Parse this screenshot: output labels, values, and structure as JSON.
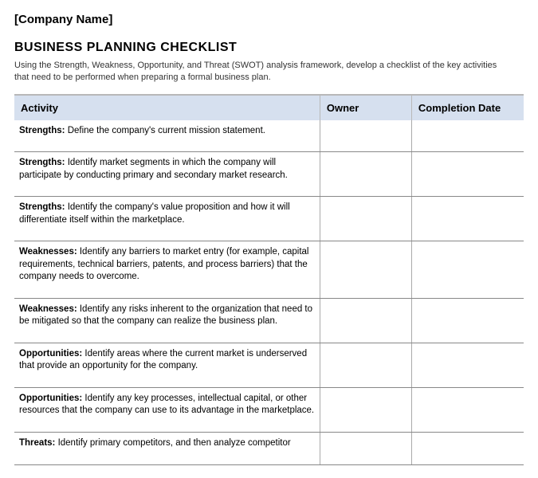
{
  "company_name": "[Company Name]",
  "title": "BUSINESS PLANNING CHECKLIST",
  "description": "Using the Strength, Weakness, Opportunity, and Threat (SWOT) analysis framework, develop a checklist of the key activities that need to be performed when preparing a formal business plan.",
  "headers": {
    "activity": "Activity",
    "owner": "Owner",
    "completion_date": "Completion Date"
  },
  "rows": [
    {
      "category": "Strengths:",
      "text": " Define the company's current mission statement.",
      "owner": "",
      "date": ""
    },
    {
      "category": "Strengths:",
      "text": " Identify market segments in which the company will participate by conducting primary and secondary market research.",
      "owner": "",
      "date": ""
    },
    {
      "category": "Strengths:",
      "text": " Identify the company's value proposition and how it will differentiate itself within the marketplace.",
      "owner": "",
      "date": ""
    },
    {
      "category": "Weaknesses:",
      "text": " Identify any barriers to market entry (for example, capital requirements, technical barriers, patents, and process barriers) that the company needs to overcome.",
      "owner": "",
      "date": ""
    },
    {
      "category": "Weaknesses:",
      "text": " Identify any risks inherent to the organization that need to be mitigated so that the company can realize the business plan.",
      "owner": "",
      "date": ""
    },
    {
      "category": "Opportunities:",
      "text": " Identify areas where the current market is underserved that provide an opportunity for the company.",
      "owner": "",
      "date": ""
    },
    {
      "category": "Opportunities:",
      "text": " Identify any key processes, intellectual capital, or other resources that the company can use to its advantage in the marketplace.",
      "owner": "",
      "date": ""
    },
    {
      "category": "Threats:",
      "text": " Identify primary competitors, and then analyze competitor",
      "owner": "",
      "date": ""
    }
  ]
}
